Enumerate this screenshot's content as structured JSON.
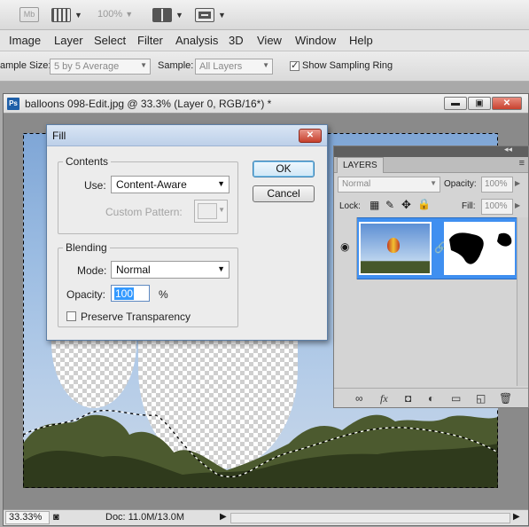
{
  "toolbar": {
    "mb_label": "Mb",
    "zoom": "100%"
  },
  "menu": [
    "Image",
    "Layer",
    "Select",
    "Filter",
    "Analysis",
    "3D",
    "View",
    "Window",
    "Help"
  ],
  "options_bar": {
    "sample_size_label": "ample Size:",
    "sample_size_value": "5 by 5 Average",
    "sample_label": "Sample:",
    "sample_value": "All Layers",
    "show_sampling_ring_label": "Show Sampling Ring",
    "show_sampling_ring_checked": true
  },
  "document": {
    "app_badge": "Ps",
    "title": "balloons 098-Edit.jpg @ 33.3% (Layer 0, RGB/16*) *",
    "status_zoom": "33.33%",
    "status_doc": "Doc: 11.0M/13.0M"
  },
  "fill_dialog": {
    "title": "Fill",
    "contents_legend": "Contents",
    "use_label": "Use:",
    "use_value": "Content-Aware",
    "custom_pattern_label": "Custom Pattern:",
    "blending_legend": "Blending",
    "mode_label": "Mode:",
    "mode_value": "Normal",
    "opacity_label": "Opacity:",
    "opacity_value": "100",
    "opacity_unit": "%",
    "preserve_label": "Preserve Transparency",
    "ok_label": "OK",
    "cancel_label": "Cancel"
  },
  "layers_panel": {
    "tab_label": "LAYERS",
    "blend_mode": "Normal",
    "opacity_label": "Opacity:",
    "opacity_value": "100%",
    "lock_label": "Lock:",
    "fill_label": "Fill:",
    "fill_value": "100%"
  },
  "colors": {
    "selection_blue": "#3f8ff0",
    "dialog_close_red": "#c7402c",
    "sky_blue": "#9bbce2"
  }
}
